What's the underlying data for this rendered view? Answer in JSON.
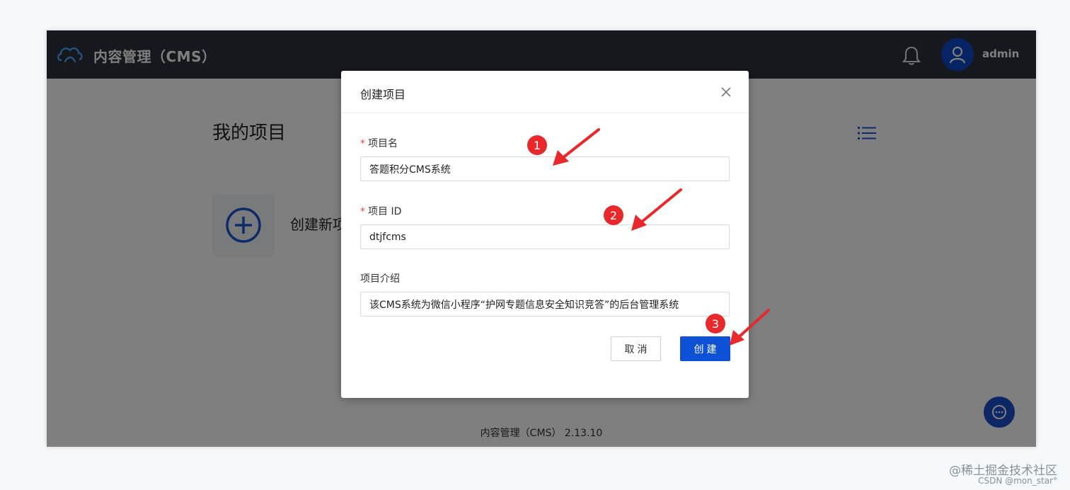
{
  "app": {
    "title": "内容管理（CMS）",
    "username": "admin",
    "footer": "内容管理（CMS） 2.13.10",
    "colors": {
      "topbar": "#2b303a",
      "primary": "#0d52d6",
      "annotation": "#e8282a"
    }
  },
  "page": {
    "title": "我的项目",
    "create_tile_label": "创建新项"
  },
  "modal": {
    "title": "创建项目",
    "fields": [
      {
        "label": "项目名",
        "required": true,
        "value": "答题积分CMS系统"
      },
      {
        "label": "项目 ID",
        "required": true,
        "value": "dtjfcms"
      },
      {
        "label": "项目介绍",
        "required": false,
        "value": "该CMS系统为微信小程序“护网专题信息安全知识竞答”的后台管理系统"
      }
    ],
    "required_mark": "*",
    "cancel_label": "取消",
    "create_label": "创建"
  },
  "annotations": {
    "badges": [
      "1",
      "2",
      "3"
    ]
  },
  "watermark": {
    "line1": "@稀土掘金技术社区",
    "line2": "CSDN @mon_star°"
  },
  "icons": [
    "cloud-logo-icon",
    "bell-icon",
    "user-icon",
    "list-icon",
    "plus-circle-icon",
    "close-icon",
    "chat-icon"
  ]
}
